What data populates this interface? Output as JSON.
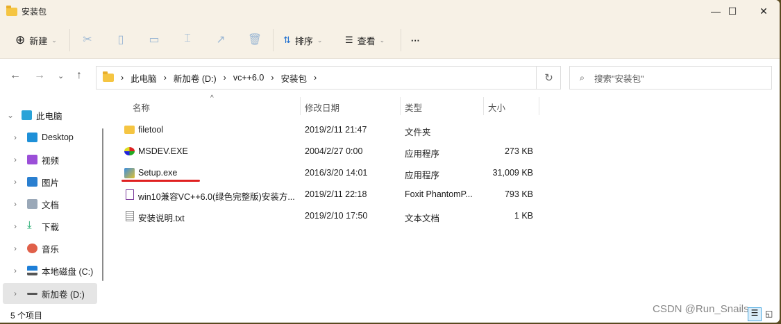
{
  "window": {
    "title": "安装包",
    "minimize": "—",
    "maximize": "☐",
    "close": "✕"
  },
  "toolbar": {
    "new_label": "新建",
    "sort_label": "排序",
    "view_label": "查看",
    "more": "···",
    "icons": [
      "cut-icon",
      "copy-icon",
      "paste-icon",
      "rename-icon",
      "share-icon",
      "delete-icon"
    ]
  },
  "address": {
    "crumbs": [
      "此电脑",
      "新加卷 (D:)",
      "vc++6.0",
      "安装包"
    ],
    "search_placeholder": "搜索\"安装包\""
  },
  "sidebar": {
    "items": [
      {
        "label": "此电脑",
        "icon": "computer-icon",
        "color": "#2aa3d8"
      },
      {
        "label": "Desktop",
        "icon": "desktop-icon",
        "color": "#1e90d8"
      },
      {
        "label": "视频",
        "icon": "video-icon",
        "color": "#9b4fd8"
      },
      {
        "label": "图片",
        "icon": "pictures-icon",
        "color": "#2a7fd0"
      },
      {
        "label": "文档",
        "icon": "documents-icon",
        "color": "#9aa8b8"
      },
      {
        "label": "下载",
        "icon": "download-icon",
        "color": "#1aa86a"
      },
      {
        "label": "音乐",
        "icon": "music-icon",
        "color": "#e0604a"
      },
      {
        "label": "本地磁盘 (C:)",
        "icon": "drive-c-icon",
        "color": "#1e7fd8"
      },
      {
        "label": "新加卷 (D:)",
        "icon": "drive-d-icon",
        "color": "#555555"
      }
    ]
  },
  "columns": {
    "name": "名称",
    "date": "修改日期",
    "type": "类型",
    "size": "大小"
  },
  "files": [
    {
      "name": "filetool",
      "date": "2019/2/11 21:47",
      "type": "文件夹",
      "size": "",
      "icon": "folder-icon"
    },
    {
      "name": "MSDEV.EXE",
      "date": "2004/2/27 0:00",
      "type": "应用程序",
      "size": "273 KB",
      "icon": "msdev-icon"
    },
    {
      "name": "Setup.exe",
      "date": "2016/3/20 14:01",
      "type": "应用程序",
      "size": "31,009 KB",
      "icon": "setup-icon"
    },
    {
      "name": "win10兼容VC++6.0(绿色完整版)安装方...",
      "date": "2019/2/11 22:18",
      "type": "Foxit PhantomP...",
      "size": "793 KB",
      "icon": "pdf-icon"
    },
    {
      "name": "安装说明.txt",
      "date": "2019/2/10 17:50",
      "type": "文本文档",
      "size": "1 KB",
      "icon": "text-file-icon"
    }
  ],
  "status": {
    "count": "5 个项目"
  },
  "watermark": "CSDN @Run_Snails",
  "accent": "#e02020"
}
